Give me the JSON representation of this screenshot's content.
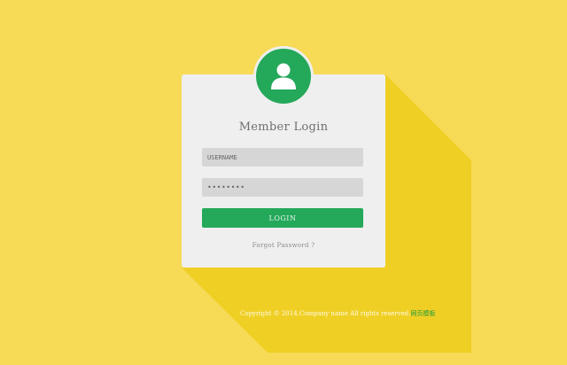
{
  "login": {
    "title": "Member Login",
    "username_placeholder": "USERNAME",
    "password_value": "••••••••",
    "login_label": "LOGIN",
    "forgot_label": "Forgot Password ?"
  },
  "footer": {
    "copyright": "Copyright © 2014.Company name All rights reserved.",
    "link_label": "网页模板"
  },
  "colors": {
    "background": "#f7da55",
    "shadow": "#efcf24",
    "card": "#efefef",
    "accent_green": "#24a85a",
    "input_bg": "#d6d6d6"
  },
  "icons": {
    "avatar": "user-icon"
  }
}
